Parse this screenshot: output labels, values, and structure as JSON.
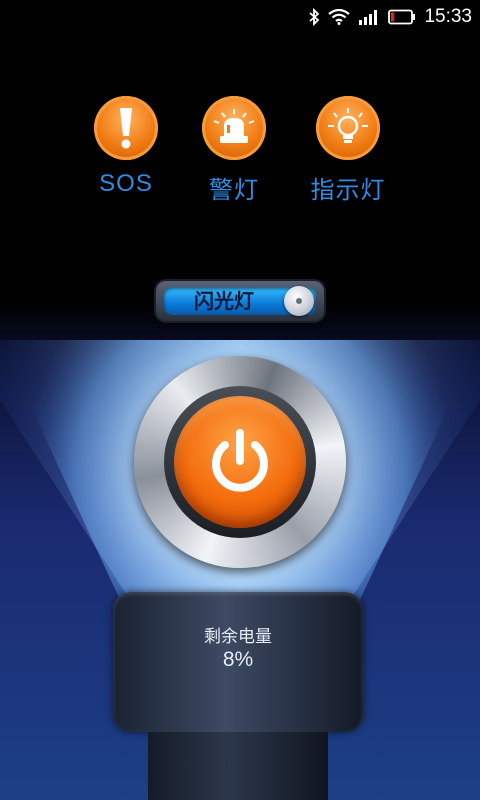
{
  "status_bar": {
    "time": "15:33",
    "icons": [
      "bluetooth-icon",
      "wifi-icon",
      "signal-icon",
      "battery-icon"
    ],
    "battery_level": 0.08
  },
  "modes": [
    {
      "id": "sos",
      "label": "SOS",
      "icon": "exclamation-icon"
    },
    {
      "id": "police",
      "label": "警灯",
      "icon": "police-light-icon"
    },
    {
      "id": "indicator",
      "label": "指示灯",
      "icon": "bulb-icon"
    }
  ],
  "blink_toggle": {
    "label": "闪光灯",
    "state": "on"
  },
  "power_button": {
    "icon": "power-icon"
  },
  "battery": {
    "label": "剩余电量",
    "value": "8%"
  },
  "colors": {
    "accent_blue": "#2d8de6",
    "button_orange": "#f36c0c",
    "toggle_blue": "#1aa0f0",
    "battery_low_red": "#e02424"
  }
}
